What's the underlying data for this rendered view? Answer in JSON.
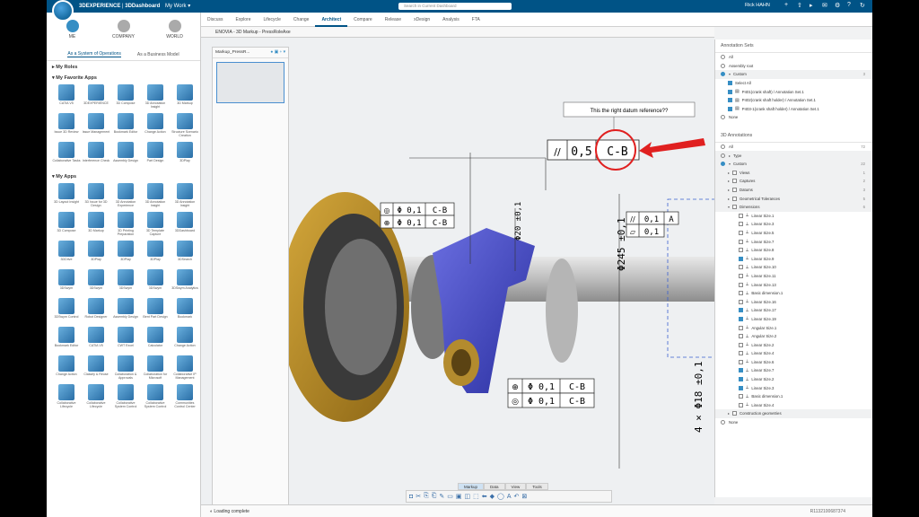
{
  "topbar": {
    "brand_bold": "3DEXPERIENCE",
    "brand_sep": " | ",
    "brand_app": "3DDashboard",
    "brand_tab": "My Work",
    "search_placeholder": "Search in Current Dashboard",
    "user": "Rick HAHN"
  },
  "tabs": [
    "Discuss",
    "Explore",
    "Lifecycle",
    "Change",
    "Architect",
    "Compare",
    "Release",
    "xDesign",
    "Analysis",
    "FTA"
  ],
  "active_tab": "Architect",
  "left": {
    "roles": [
      "ME",
      "COMPANY",
      "WORLD"
    ],
    "segments": [
      "As a System of Operations",
      "As a Business Model"
    ],
    "sec_roles": "My Roles",
    "sec_fav": "My Favorite Apps",
    "sec_apps": "My Apps",
    "fav_apps": [
      "CATIA V5",
      "3DEXPERIENCE",
      "3D Compose",
      "3D Annotation Insight",
      "3D Markup",
      "Issue 3D Review",
      "Issue Management",
      "Bookmark Editor",
      "Change Action",
      "Structure Scenario Creation",
      "Collaborative Tasks",
      "Interference Check",
      "Assembly Design",
      "Part Design",
      "3DPlay"
    ],
    "my_apps": [
      "3D Layout Insight",
      "3D Issue for 3D Design",
      "3D Annotation Experience",
      "3D Annotation Insight",
      "3D Annotation Insight",
      "3D Compose",
      "3D Markup",
      "3D Printing Preparation",
      "3D Template Capture",
      "3DDashboard",
      "3DDrive",
      "3DPlay",
      "3DPlay",
      "3DPlay",
      "3DSearch",
      "3DSwym",
      "3DSwym",
      "3DSwym",
      "3DSwym",
      "3DSwym Analytics",
      "3DSwym Control",
      "Robot Designer",
      "Assembly Design",
      "Bent Part Design",
      "Bookmark",
      "Bookmark Editor",
      "CATIA V5",
      "CWT Excel",
      "Calculator",
      "Change Action",
      "Change Action",
      "Classify & Reuse",
      "Collaboration & Approvals",
      "Collaboration for Microsoft",
      "Collaborative IP Management",
      "Collaborative Lifecycle",
      "Collaborative Lifecycle",
      "Collaborative System Control Center",
      "Collaborative System Control Center",
      "Communities Control Center"
    ]
  },
  "viewer": {
    "title": "ENOVIA - 3D Markup - PressRoleAxe",
    "thumb_title": "Markup_PressR...",
    "annotation_note": "This the right datum reference??",
    "fcf_top": [
      "//",
      "0,5",
      "C-B"
    ],
    "fcf_left1": [
      "◎",
      "Φ 0,1",
      "C-B"
    ],
    "fcf_left2": [
      "⊕",
      "Φ 0,1",
      "C-B"
    ],
    "fcf_right1": [
      "//",
      "0,1",
      "A"
    ],
    "fcf_right2": [
      "▱",
      "0,1"
    ],
    "fcf_bottom1": [
      "⊕",
      "Φ 0,1",
      "C-B"
    ],
    "fcf_bottom2": [
      "◎",
      "Φ 0,1",
      "C-B"
    ],
    "dim_vertical": "Φ245 ±0,1",
    "dim_vertical2": "Φ20 ±0,1",
    "dim_right": "4 × Φ18 ±0,1"
  },
  "bottom_tabs": [
    "Markup",
    "Data",
    "View",
    "Tools"
  ],
  "status": {
    "text": "Loading complete",
    "ref": "R1132100687374"
  },
  "right": {
    "sets_title": "Annotation Sets",
    "set_all": "All",
    "set_assembly": "Assembly root",
    "set_custom": "Custom",
    "set_custom_count": "3",
    "select_all": "Select All",
    "sets": [
      "P401(crank shaft) / Annotation Set.1",
      "P402(crank shaft holder) / Annotation Set.1",
      "P403-1(crank shaft holder) / Annotation Set.1"
    ],
    "set_none": "None",
    "ann_title": "3D Annotations",
    "ann_all": "All",
    "ann_all_count": "72",
    "ann_type": "Type",
    "ann_custom": "Custom",
    "ann_custom_count": "22",
    "groups": [
      {
        "label": "Views",
        "count": "1"
      },
      {
        "label": "Captures",
        "count": "2"
      },
      {
        "label": "Datums",
        "count": "3"
      },
      {
        "label": "Geometrical Tolerances",
        "count": "5"
      },
      {
        "label": "Dimensions",
        "count": "6"
      }
    ],
    "dims": [
      {
        "label": "Linear Size.1",
        "on": false
      },
      {
        "label": "Linear Size.3",
        "on": false
      },
      {
        "label": "Linear Size.5",
        "on": false
      },
      {
        "label": "Linear Size.7",
        "on": false
      },
      {
        "label": "Linear Size.8",
        "on": false
      },
      {
        "label": "Linear Size.9",
        "on": true
      },
      {
        "label": "Linear Size.10",
        "on": false
      },
      {
        "label": "Linear Size.11",
        "on": false
      },
      {
        "label": "Linear Size.13",
        "on": false
      },
      {
        "label": "Basic dimension.1",
        "on": false
      },
      {
        "label": "Linear Size.16",
        "on": false
      },
      {
        "label": "Linear Size.17",
        "on": true
      },
      {
        "label": "Linear Size.19",
        "on": true
      },
      {
        "label": "Angular Size.1",
        "on": false
      },
      {
        "label": "Angular Size.2",
        "on": false
      },
      {
        "label": "Linear Size.2",
        "on": false
      },
      {
        "label": "Linear Size.4",
        "on": false
      },
      {
        "label": "Linear Size.6",
        "on": false
      },
      {
        "label": "Linear Size.7",
        "on": true
      },
      {
        "label": "Linear Size.2",
        "on": true
      },
      {
        "label": "Linear Size.3",
        "on": true
      },
      {
        "label": "Basic dimension.1",
        "on": false
      },
      {
        "label": "Linear Size.4",
        "on": false
      }
    ],
    "construction": "Construction geometries",
    "ann_none": "None"
  },
  "colors": {
    "brand": "#005386",
    "accent": "#368ec4",
    "highlight": "#e02020"
  }
}
